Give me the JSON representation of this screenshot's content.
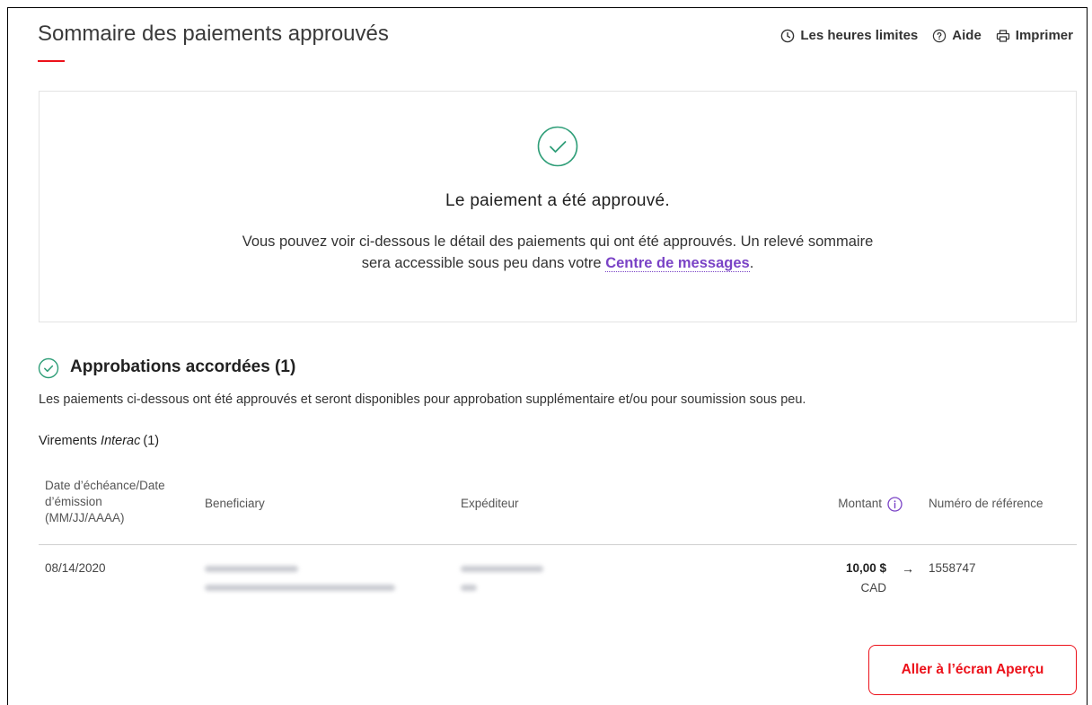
{
  "page": {
    "title": "Sommaire des paiements approuvés"
  },
  "header_links": [
    {
      "icon": "clock-icon",
      "label": "Les heures limites"
    },
    {
      "icon": "help-circle-icon",
      "label": "Aide"
    },
    {
      "icon": "printer-icon",
      "label": "Imprimer"
    }
  ],
  "confirmation": {
    "icon": "check-circle-icon",
    "heading": "Le paiement a été approuvé.",
    "message_line1": "Vous pouvez voir ci-dessous le détail des paiements qui ont été approuvés. Un relevé sommaire",
    "message_line2_prefix": "sera accessible sous peu dans votre ",
    "message_link": "Centre de messages",
    "message_line2_suffix": "."
  },
  "approvals": {
    "icon": "check-circle-icon",
    "title": "Approbations accordées (1)",
    "description": "Les paiements ci-dessous ont été approuvés et seront disponibles pour approbation supplémentaire et/ou pour soumission sous peu.",
    "group": {
      "prefix": "Virements",
      "brand": "Interac",
      "count": "(1)"
    }
  },
  "table": {
    "columns": {
      "date_lines": [
        "Date d’échéance/Date",
        "d’émission",
        "(MM/JJ/AAAA)"
      ],
      "beneficiary": "Beneficiary",
      "sender": "Expéditeur",
      "amount": "Montant",
      "amount_info_icon": "info-icon",
      "reference": "Numéro de référence"
    },
    "rows": [
      {
        "date": "08/14/2020",
        "amount": "10,00 $",
        "arrow": "→",
        "currency": "CAD",
        "reference": "1558747"
      }
    ]
  },
  "actions": {
    "overview_button": "Aller à l’écran Aperçu"
  },
  "colors": {
    "accent": "#ec111a",
    "success": "#2f9e78",
    "link": "#7a43c6",
    "text": "#333333"
  }
}
